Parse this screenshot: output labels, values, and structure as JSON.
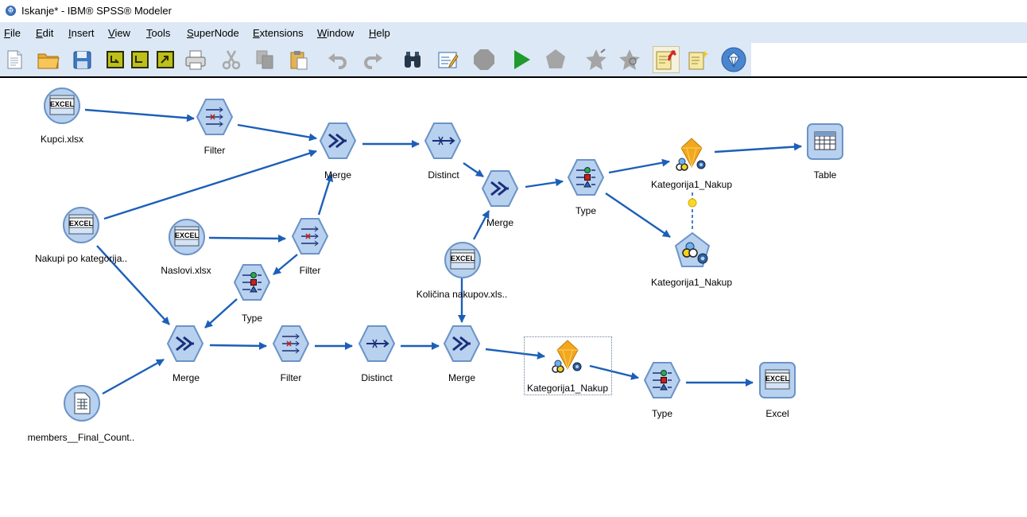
{
  "window": {
    "title": "Iskanje* - IBM® SPSS® Modeler"
  },
  "menu": {
    "file": {
      "u": "F",
      "rest": "ile"
    },
    "edit": {
      "u": "E",
      "rest": "dit"
    },
    "insert": {
      "u": "I",
      "rest": "nsert"
    },
    "view": {
      "u": "V",
      "rest": "iew"
    },
    "tools": {
      "u": "T",
      "rest": "ools"
    },
    "supernode": {
      "u": "S",
      "rest": "uperNode"
    },
    "extensions": {
      "u": "E",
      "rest": "xtensions"
    },
    "window": {
      "u": "W",
      "rest": "indow"
    },
    "help": {
      "u": "H",
      "rest": "elp"
    }
  },
  "toolbar_icons": [
    "new-stream-icon",
    "open-folder-icon",
    "save-icon",
    "insert-node-icon",
    "insert-supernode-icon",
    "export-icon",
    "print-icon",
    "cut-icon",
    "copy-icon",
    "paste-icon",
    "undo-icon",
    "redo-icon",
    "find-binoculars-icon",
    "annotate-icon",
    "stop-icon",
    "run-icon",
    "run-selection-icon",
    "preview-icon",
    "preview-selection-icon",
    "comment-pin-icon",
    "new-comment-icon",
    "model-nugget-icon"
  ],
  "nodes": {
    "kupci": {
      "label": "Kupci.xlsx"
    },
    "filter1": {
      "label": "Filter"
    },
    "merge1": {
      "label": "Merge"
    },
    "distinct1": {
      "label": "Distinct"
    },
    "merge2": {
      "label": "Merge"
    },
    "type1": {
      "label": "Type"
    },
    "nugget1": {
      "label": "Kategorija1_Nakup"
    },
    "table": {
      "label": "Table"
    },
    "model1": {
      "label": "Kategorija1_Nakup"
    },
    "nakupi": {
      "label": "Nakupi po kategorija.."
    },
    "naslovi": {
      "label": "Naslovi.xlsx"
    },
    "filter2": {
      "label": "Filter"
    },
    "type2": {
      "label": "Type"
    },
    "kolicina": {
      "label": "Količina nakupov.xls.."
    },
    "merge3": {
      "label": "Merge"
    },
    "filter3": {
      "label": "Filter"
    },
    "distinct2": {
      "label": "Distinct"
    },
    "merge4": {
      "label": "Merge"
    },
    "nugget2": {
      "label": "Kategorija1_Nakup"
    },
    "type3": {
      "label": "Type"
    },
    "excel_out": {
      "label": "Excel"
    },
    "members": {
      "label": "members__Final_Count.."
    }
  },
  "badges": {
    "excel": "EXCEL"
  },
  "colors": {
    "menubar": "#dce8f5",
    "node_fill": "#b7d1ef",
    "node_stroke": "#6b93c7",
    "connector": "#1c5fb8",
    "nugget": "#f2a81d"
  }
}
